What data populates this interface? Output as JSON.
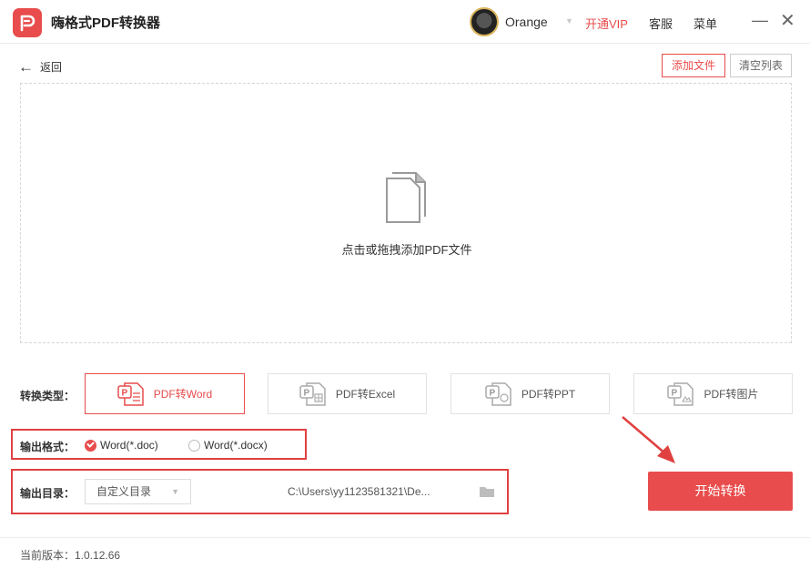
{
  "titlebar": {
    "app_title": "嗨格式PDF转换器",
    "user_name": "Orange",
    "user_caret": "▼",
    "vip_label": "开通VIP",
    "service_label": "客服",
    "menu_label": "菜单",
    "minimize_glyph": "—",
    "close_glyph": "✕"
  },
  "toolbar": {
    "back_label": "返回",
    "add_file_label": "添加文件",
    "clear_list_label": "清空列表"
  },
  "drop_zone": {
    "hint": "点击或拖拽添加PDF文件"
  },
  "conversion": {
    "label": "转换类型：",
    "options": [
      {
        "label": "PDF转Word",
        "icon": "word-doc-icon",
        "active": true
      },
      {
        "label": "PDF转Excel",
        "icon": "excel-doc-icon",
        "active": false
      },
      {
        "label": "PDF转PPT",
        "icon": "ppt-doc-icon",
        "active": false
      },
      {
        "label": "PDF转图片",
        "icon": "image-doc-icon",
        "active": false
      }
    ]
  },
  "output_format": {
    "label": "输出格式：",
    "options": [
      {
        "label": "Word(*.doc)",
        "selected": true
      },
      {
        "label": "Word(*.docx)",
        "selected": false
      }
    ]
  },
  "output_dir": {
    "label": "输出目录：",
    "select_value": "自定义目录",
    "caret": "▼",
    "path": "C:\\Users\\yy1123581321\\De..."
  },
  "start_button": "开始转换",
  "footer": {
    "version_text": "当前版本：1.0.12.66"
  },
  "colors": {
    "accent": "#e84c4c",
    "annotation_red": "#e04040"
  }
}
